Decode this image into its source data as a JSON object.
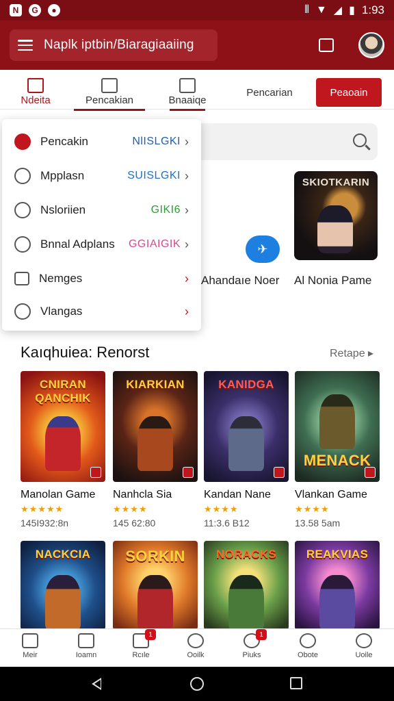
{
  "status_bar": {
    "time": "1:93",
    "left_icons": [
      "N",
      "G",
      "●"
    ]
  },
  "header": {
    "title": "Naplk iptbin/Biaragiaaiing"
  },
  "tabs": [
    {
      "label": "Ndeita"
    },
    {
      "label": "Pencakian"
    },
    {
      "label": "Bnaaiqe"
    },
    {
      "label": "Pencarian"
    }
  ],
  "red_button": {
    "label": "Peaoain"
  },
  "menu": {
    "items": [
      {
        "label": "Pencakin",
        "value": "NlISLGKI",
        "color": "#1f5fb0"
      },
      {
        "label": "Mpplasn",
        "value": "SUISLGKI",
        "color": "#1f6fc9"
      },
      {
        "label": "Nsloriien",
        "value": "GIKI6",
        "color": "#2f9b3a"
      },
      {
        "label": "Bnnal Adplans",
        "value": "GGIAIGIK",
        "color": "#d14b8b"
      },
      {
        "label": "Nemges",
        "value": ""
      },
      {
        "label": "Vlangas",
        "value": ""
      }
    ]
  },
  "featured": {
    "thumb_title": "SKIOTKARIN",
    "labels": [
      "Ahandaıe Noer",
      "Al Nonia Pame"
    ]
  },
  "section": {
    "title": "Kaıqhuiea: Renorst",
    "more": "Retape ▸"
  },
  "games_row1": [
    {
      "title_art": "CNIRAN QANCHIK",
      "name": "Manolan Game",
      "stars": "★★★★★",
      "meta": "145I932:8n"
    },
    {
      "title_art": "KIARKIAN",
      "name": "Nanhcla Sia",
      "stars": "★★★★",
      "meta": "145 62:80"
    },
    {
      "title_art": "KANIDGA",
      "name": "Kandan Nane",
      "stars": "★★★★",
      "meta": "11:3.6 B12"
    },
    {
      "title_art": "MENACK",
      "name": "Vlankan Game",
      "stars": "★★★★",
      "meta": "13.58 5am"
    }
  ],
  "games_row2": [
    {
      "title_art": "NACKCIA"
    },
    {
      "title_art": "SORKIN"
    },
    {
      "title_art": "NORACKS"
    },
    {
      "title_art": "REAKVIAS"
    }
  ],
  "bottom_nav": [
    {
      "label": "Meir",
      "badge": ""
    },
    {
      "label": "Ioamn",
      "badge": ""
    },
    {
      "label": "Rcıle",
      "badge": "1"
    },
    {
      "label": "Ooilk",
      "badge": ""
    },
    {
      "label": "Piuks",
      "badge": "1"
    },
    {
      "label": "Obote",
      "badge": ""
    },
    {
      "label": "Uoile",
      "badge": ""
    }
  ]
}
